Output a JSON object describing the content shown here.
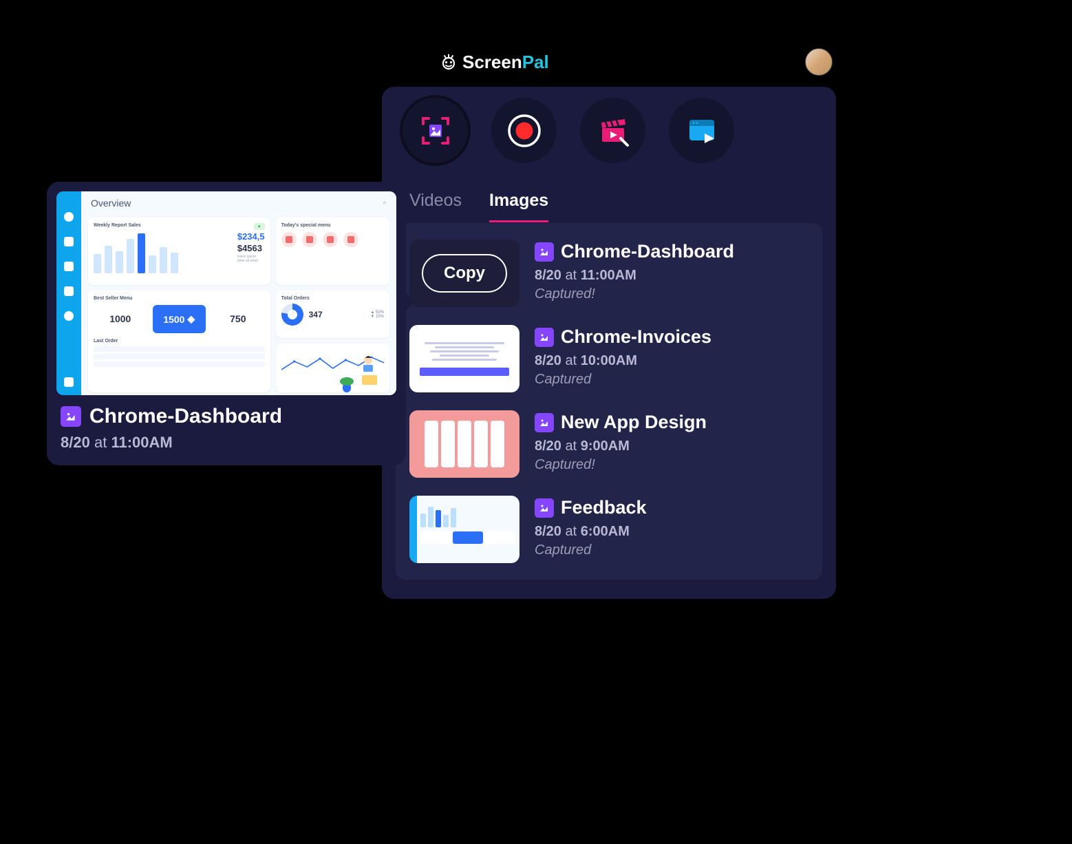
{
  "brand": {
    "name_white": "Screen",
    "name_teal": "Pal"
  },
  "tabs": {
    "videos": "Videos",
    "images": "Images"
  },
  "copy_label": "Copy",
  "list": [
    {
      "title": "Chrome-Dashboard",
      "date": "8/20",
      "at": "at",
      "time": "11:00AM",
      "status": "Captured!"
    },
    {
      "title": "Chrome-Invoices",
      "date": "8/20",
      "at": "at",
      "time": "10:00AM",
      "status": "Captured"
    },
    {
      "title": "New App Design",
      "date": "8/20",
      "at": "at",
      "time": "9:00AM",
      "status": "Captured!"
    },
    {
      "title": "Feedback",
      "date": "8/20",
      "at": "at",
      "time": "6:00AM",
      "status": "Captured"
    }
  ],
  "preview": {
    "title": "Chrome-Dashboard",
    "date": "8/20",
    "at": "at",
    "time": "11:00AM",
    "dashboard": {
      "overview_label": "Overview",
      "weekly_report_label": "Weekly Report Sales",
      "num_primary": "$234,5",
      "num_secondary": "$4563",
      "special_menu_label": "Today's special menu",
      "total_orders_label": "Total Orders",
      "total_orders_value": "347",
      "pct1": "50%",
      "pct2": "15%",
      "best_seller_label": "Best Seller Menu",
      "tile1": "1000",
      "tile2": "1500",
      "tile3": "750",
      "last_order_label": "Last Order"
    }
  }
}
